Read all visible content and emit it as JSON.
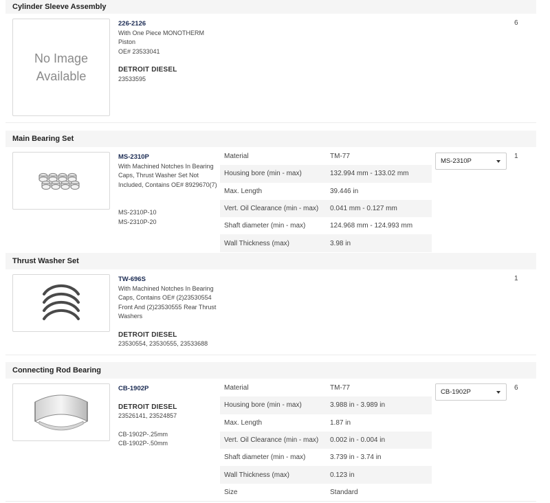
{
  "sections": [
    {
      "title": "Cylinder Sleeve Assembly",
      "image_text": [
        "No Image",
        "Available"
      ],
      "part_number": "226-2126",
      "description": [
        "With One Piece MONOTHERM Piston",
        "OE# 23533041"
      ],
      "brand": "DETROIT DIESEL",
      "brand_numbers": "23533595",
      "quantity": "6"
    },
    {
      "title": "Main Bearing Set",
      "image": "bearing-set-icon",
      "part_number": "MS-2310P",
      "description": [
        "With Machined Notches In Bearing",
        "Caps, Thrust Washer Set Not",
        "Included, Contains OE# 8929670(7)"
      ],
      "variants": [
        "MS-2310P-10",
        "MS-2310P-20"
      ],
      "specs": [
        {
          "label": "Material",
          "value": "TM-77"
        },
        {
          "label": "Housing bore (min - max)",
          "value": "132.994 mm - 133.02 mm"
        },
        {
          "label": "Max. Length",
          "value": "39.446 in"
        },
        {
          "label": "Vert. Oil Clearance (min - max)",
          "value": "0.041 mm - 0.127 mm"
        },
        {
          "label": "Shaft diameter (min - max)",
          "value": "124.968 mm - 124.993 mm"
        },
        {
          "label": "Wall Thickness (max)",
          "value": "3.98 in"
        }
      ],
      "selected": "MS-2310P",
      "quantity": "1"
    },
    {
      "title": "Thrust Washer Set",
      "image": "thrust-washer-icon",
      "part_number": "TW-696S",
      "description": [
        "With Machined Notches In Bearing",
        "Caps, Contains OE# (2)23530554",
        "Front And (2)23530555 Rear Thrust",
        "Washers"
      ],
      "brand": "DETROIT DIESEL",
      "brand_numbers": "23530554, 23530555, 23533688",
      "quantity": "1"
    },
    {
      "title": "Connecting Rod Bearing",
      "image": "rod-bearing-icon",
      "part_number": "CB-1902P",
      "brand": "DETROIT DIESEL",
      "brand_numbers": "23526141, 23524857",
      "variants": [
        "CB-1902P-.25mm",
        "CB-1902P-.50mm"
      ],
      "specs": [
        {
          "label": "Material",
          "value": "TM-77"
        },
        {
          "label": "Housing bore (min - max)",
          "value": "3.988 in - 3.989 in"
        },
        {
          "label": "Max. Length",
          "value": "1.87 in"
        },
        {
          "label": "Vert. Oil Clearance (min - max)",
          "value": "0.002 in - 0.004 in"
        },
        {
          "label": "Shaft diameter (min - max)",
          "value": "3.739 in - 3.74 in"
        },
        {
          "label": "Wall Thickness (max)",
          "value": "0.123 in"
        },
        {
          "label": "Size",
          "value": "Standard"
        }
      ],
      "selected": "CB-1902P",
      "quantity": "6"
    }
  ],
  "colors": {
    "accent": "#1a2a52",
    "header_bg": "#f5f5f5",
    "row_alt": "#f4f4f4"
  }
}
